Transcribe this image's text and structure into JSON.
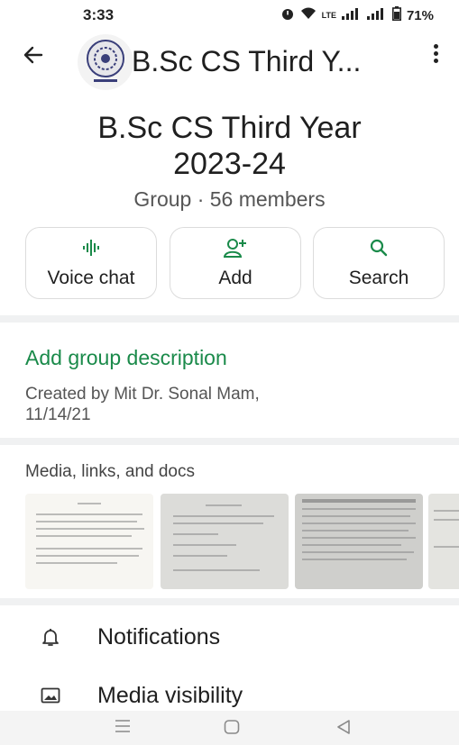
{
  "status": {
    "time": "3:33",
    "alarm_icon": "alarm-icon",
    "wifi_icon": "wifi-icon",
    "volte": "LTE",
    "battery": "71%"
  },
  "app_bar": {
    "title": "B.Sc CS Third Y...",
    "avatar_label": "MIT"
  },
  "group": {
    "name_line1": "B.Sc CS Third Year",
    "name_line2": "2023-24",
    "meta": "Group · 56 members"
  },
  "actions": [
    {
      "label": "Voice chat",
      "icon": "voice-chat-icon"
    },
    {
      "label": "Add",
      "icon": "add-person-icon"
    },
    {
      "label": "Search",
      "icon": "search-icon"
    }
  ],
  "description": {
    "add_label": "Add group description",
    "created_line1": "Created by Mit Dr. Sonal Mam,",
    "created_line2": "11/14/21"
  },
  "media": {
    "title": "Media, links, and docs"
  },
  "settings": [
    {
      "label": "Notifications",
      "icon": "bell-icon"
    },
    {
      "label": "Media visibility",
      "icon": "image-icon"
    }
  ],
  "colors": {
    "accent": "#1a8a4a",
    "divider": "#f0f1f2"
  }
}
